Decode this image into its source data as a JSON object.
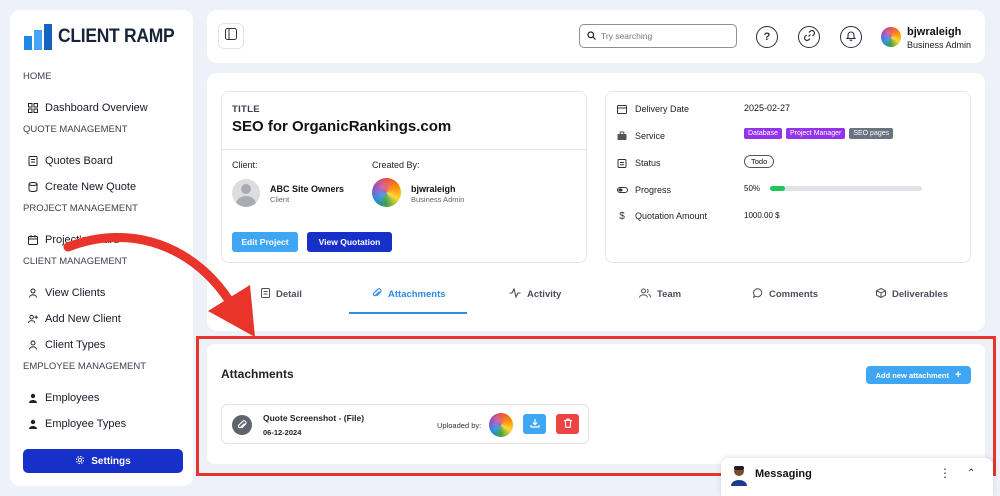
{
  "brand": {
    "name": "CLIENT RAMP"
  },
  "sidebar": {
    "sections": [
      {
        "title": "HOME",
        "items": [
          "Dashboard Overview"
        ]
      },
      {
        "title": "QUOTE MANAGEMENT",
        "items": [
          "Quotes Board",
          "Create New Quote"
        ]
      },
      {
        "title": "PROJECT MANAGEMENT",
        "items": [
          "Project's Board"
        ]
      },
      {
        "title": "CLIENT MANAGEMENT",
        "items": [
          "View Clients",
          "Add New Client",
          "Client Types"
        ]
      },
      {
        "title": "EMPLOYEE MANAGEMENT",
        "items": [
          "Employees",
          "Employee Types"
        ]
      }
    ],
    "settings_label": "Settings"
  },
  "header": {
    "search_placeholder": "Try searching",
    "user_name": "bjwraleigh",
    "user_role": "Business Admin"
  },
  "project": {
    "title_label": "TITLE",
    "title": "SEO for OrganicRankings.com",
    "client_label": "Client:",
    "created_by_label": "Created By:",
    "client_name": "ABC Site Owners",
    "client_role": "Client",
    "creator_name": "bjwraleigh",
    "creator_role": "Business Admin",
    "edit_label": "Edit Project",
    "view_quotation_label": "View Quotation"
  },
  "info": {
    "delivery_label": "Delivery Date",
    "delivery_value": "2025-02-27",
    "service_label": "Service",
    "service_tags": [
      {
        "text": "Database",
        "color": "#9333ea"
      },
      {
        "text": "Project Manager",
        "color": "#9333ea"
      },
      {
        "text": "SEO pages",
        "color": "#6b7280"
      }
    ],
    "status_label": "Status",
    "status_value": "Todo",
    "progress_label": "Progress",
    "progress_text": "50%",
    "progress_value": 0.1,
    "amount_label": "Quotation Amount",
    "amount_value": "1000.00 $"
  },
  "tabs": {
    "detail": "Detail",
    "attachments": "Attachments",
    "activity": "Activity",
    "team": "Team",
    "comments": "Comments",
    "deliverables": "Deliverables",
    "active": "attachments"
  },
  "attachments": {
    "title": "Attachments",
    "add_label": "Add new attachment",
    "files": [
      {
        "name": "Quote Screenshot - (File)",
        "date": "06-12-2024",
        "uploaded_by_label": "Uploaded by:"
      }
    ]
  },
  "messaging": {
    "label": "Messaging"
  },
  "colors": {
    "primary": "#1730c9",
    "accent": "#3fa6f4",
    "annotation": "#e8342a",
    "danger": "#ef4444",
    "success": "#21c55d"
  }
}
